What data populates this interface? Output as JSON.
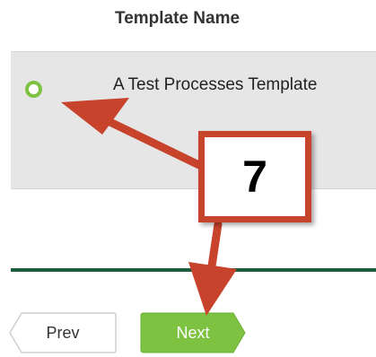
{
  "table": {
    "header": "Template Name",
    "rows": [
      {
        "label": "A Test Processes Template",
        "selected": true
      }
    ]
  },
  "pagination": {
    "prev_label": "Prev",
    "next_label": "Next"
  },
  "annotation": {
    "step_number": "7"
  },
  "colors": {
    "accent_green": "#7ec242",
    "divider_green": "#1b5e3d",
    "callout_red": "#c8432b",
    "row_background": "#e6e6e6"
  }
}
